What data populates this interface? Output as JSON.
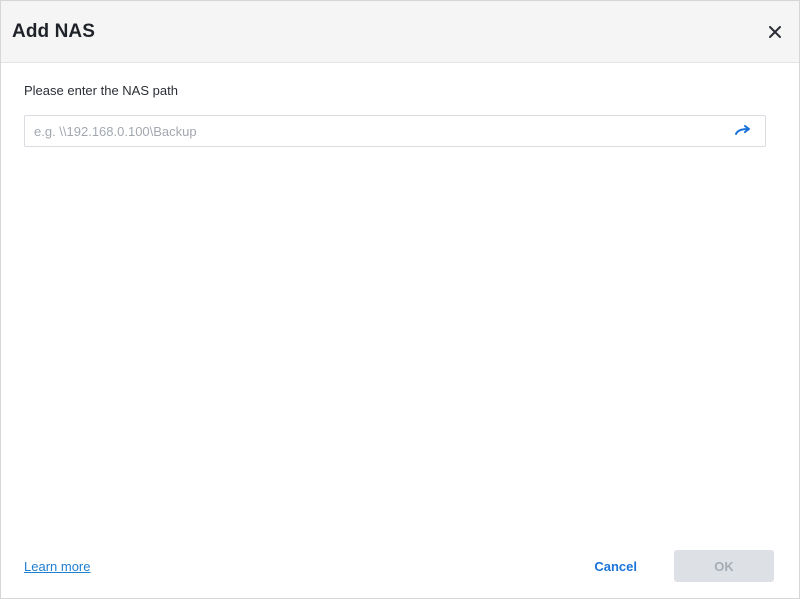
{
  "dialog": {
    "title": "Add NAS",
    "close_icon": "close-icon"
  },
  "form": {
    "prompt": "Please enter the NAS path",
    "path_value": "",
    "path_placeholder": "e.g. \\\\192.168.0.100\\Backup",
    "go_icon": "arrow-right-icon"
  },
  "footer": {
    "learn_more": "Learn more",
    "cancel_label": "Cancel",
    "ok_label": "OK"
  },
  "colors": {
    "accent": "#1a73d9",
    "title_bar_bg": "#f5f5f5",
    "disabled_button_bg": "#dde1e6",
    "disabled_button_text": "#a6acb4"
  }
}
